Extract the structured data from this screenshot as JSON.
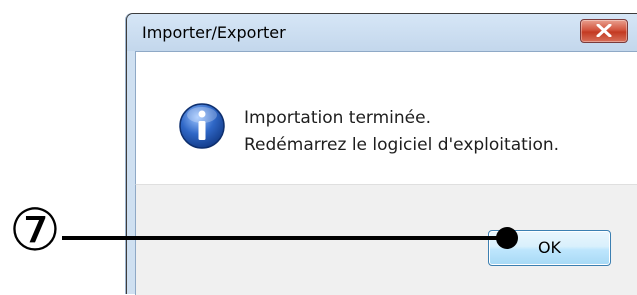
{
  "window": {
    "title": "Importer/Exporter",
    "close_icon": "close-icon"
  },
  "message": {
    "icon": "info-icon",
    "line1": "Importation terminée.",
    "line2": "Redémarrez le logiciel d'exploitation."
  },
  "buttons": {
    "ok_label": "OK"
  },
  "callout": {
    "number": "⑦"
  },
  "colors": {
    "title_bar": "#c9dcf0",
    "close_button": "#c94a34",
    "ok_button_border": "#3c7fb1",
    "info_icon": "#2f67c6"
  }
}
